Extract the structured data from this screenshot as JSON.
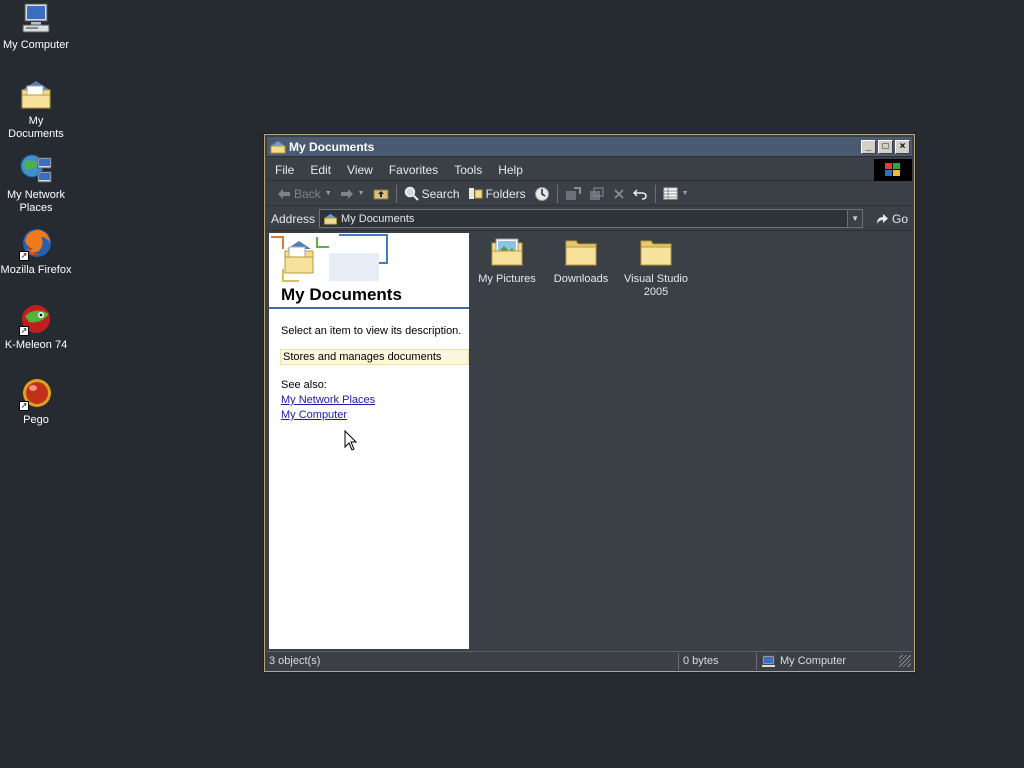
{
  "desktop": {
    "icons": [
      {
        "label": "My Computer"
      },
      {
        "label": "My Documents"
      },
      {
        "label": "My Network\nPlaces"
      },
      {
        "label": "Mozilla Firefox"
      },
      {
        "label": "K-Meleon 74"
      },
      {
        "label": "Pego"
      }
    ]
  },
  "window": {
    "title": "My Documents",
    "title_buttons": {
      "minimize": "_",
      "maximize": "□",
      "close": "×"
    },
    "menu": [
      "File",
      "Edit",
      "View",
      "Favorites",
      "Tools",
      "Help"
    ],
    "toolbar": {
      "back": "Back",
      "search": "Search",
      "folders": "Folders"
    },
    "address": {
      "label": "Address",
      "value": "My Documents",
      "go": "Go"
    },
    "left_pane": {
      "title": "My Documents",
      "description": "Select an item to view its description.",
      "highlight": "Stores and manages documents",
      "see_also": "See also:",
      "links": [
        "My Network Places",
        "My Computer"
      ]
    },
    "files": [
      {
        "label": "My Pictures",
        "icon": "pictures-folder-icon"
      },
      {
        "label": "Downloads",
        "icon": "folder-icon"
      },
      {
        "label": "Visual Studio\n2005",
        "icon": "folder-icon"
      }
    ],
    "status": {
      "objects": "3 object(s)",
      "size": "0 bytes",
      "zone": "My Computer"
    }
  },
  "colors": {
    "desktop": "#262b31",
    "window_bg": "#3b4047",
    "title_bar": "#4a5a72",
    "folder": "#f3dc8c",
    "link": "#1c1ca8"
  }
}
